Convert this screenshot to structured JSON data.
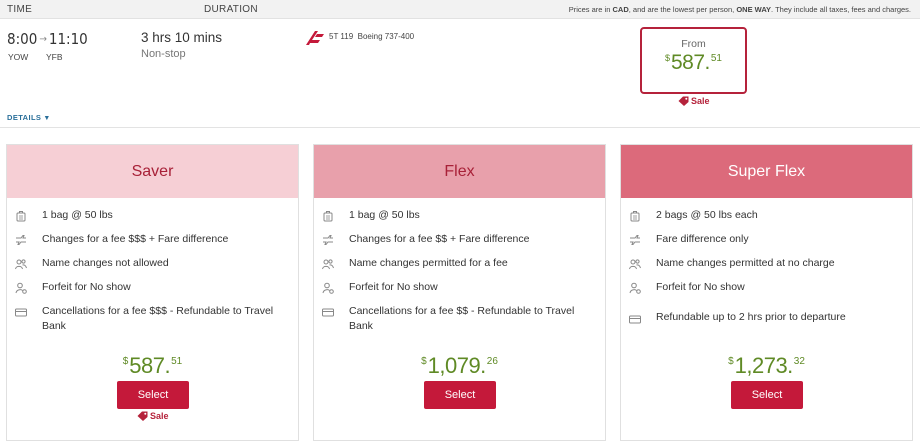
{
  "header": {
    "time_label": "TIME",
    "duration_label": "DURATION",
    "notice_pre": "Prices are in ",
    "notice_currency": "CAD",
    "notice_mid": ", and are the lowest per person, ",
    "notice_oneway": "ONE WAY",
    "notice_post": ". They include all taxes, fees and charges."
  },
  "flight": {
    "depart_time": "8:00",
    "arrow": "→",
    "arrive_time": "11:10",
    "origin": "YOW",
    "destination": "YFB",
    "duration": "3 hrs 10 mins",
    "stops": "Non-stop",
    "flight_number": "5T 119",
    "aircraft": "Boeing 737-400",
    "from_label": "From",
    "from_currency": "$",
    "from_whole": "587.",
    "from_cents": "51",
    "sale_label": "Sale",
    "details_label": "DETAILS",
    "details_caret": "▼"
  },
  "fares": [
    {
      "name": "Saver",
      "features": [
        {
          "icon": "bag-icon",
          "text": "1 bag @ 50 lbs"
        },
        {
          "icon": "change-flight-icon",
          "text": "Changes for a fee $$$ + Fare difference"
        },
        {
          "icon": "name-change-icon",
          "text": "Name changes not allowed"
        },
        {
          "icon": "no-show-icon",
          "text": "Forfeit for No show"
        },
        {
          "icon": "cancellation-icon",
          "text": "Cancellations for a fee $$$ - Refundable to Travel Bank"
        }
      ],
      "currency": "$",
      "whole": "587.",
      "cents": "51",
      "select_label": "Select",
      "sale_label": "Sale"
    },
    {
      "name": "Flex",
      "features": [
        {
          "icon": "bag-icon",
          "text": "1 bag @ 50 lbs"
        },
        {
          "icon": "change-flight-icon",
          "text": "Changes for a fee $$ + Fare difference"
        },
        {
          "icon": "name-change-icon",
          "text": "Name changes permitted for a fee"
        },
        {
          "icon": "no-show-icon",
          "text": "Forfeit for No show"
        },
        {
          "icon": "cancellation-icon",
          "text": "Cancellations for a fee $$ - Refundable to Travel Bank"
        }
      ],
      "currency": "$",
      "whole": "1,079.",
      "cents": "26",
      "select_label": "Select"
    },
    {
      "name": "Super Flex",
      "features": [
        {
          "icon": "bag-icon",
          "text": "2 bags @ 50 lbs each"
        },
        {
          "icon": "change-flight-icon",
          "text": "Fare difference only"
        },
        {
          "icon": "name-change-icon",
          "text": "Name changes permitted at no charge"
        },
        {
          "icon": "no-show-icon",
          "text": "Forfeit for No show"
        },
        {
          "icon": "cancellation-icon",
          "text": "Refundable up to 2 hrs prior to departure"
        }
      ],
      "currency": "$",
      "whole": "1,273.",
      "cents": "32",
      "select_label": "Select"
    }
  ],
  "colors": {
    "brand_red": "#c4193a",
    "price_green": "#5f8a25",
    "saver_header": "#f6cfd5",
    "flex_header": "#e8a0ab",
    "superflex_header": "#dc6a7b"
  }
}
